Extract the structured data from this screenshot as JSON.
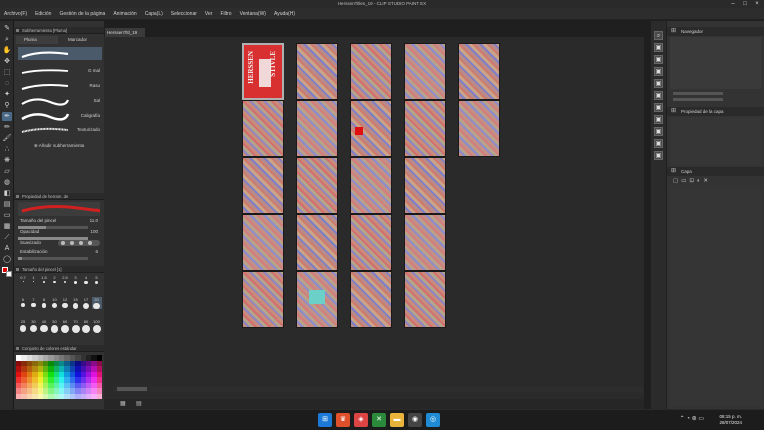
{
  "window": {
    "title": "HerssenTitles_19 - CLIP STUDIO PAINT EX"
  },
  "menu": [
    "Archivo(F)",
    "Edición",
    "Gestión de la página",
    "Animación",
    "Capa(L)",
    "Seleccionar",
    "Ver",
    "Filtro",
    "Ventana(W)",
    "Ayuda(H)"
  ],
  "left_panel": {
    "subtool_header": "Subherramienta [Pluma]",
    "tabs": [
      "Pluma",
      "Marcador"
    ],
    "brushes": [
      "",
      "G mal",
      "Rasu",
      "Sal",
      "Caligrafía",
      "Texturizado"
    ],
    "add_subtool": "Añadir subherramienta",
    "tool_props_header": "Propiedad de herram. de",
    "props": {
      "brush_size_label": "Tamaño del pincel",
      "brush_size_value": "11.0",
      "opacity_label": "Opacidad",
      "opacity_value": "100",
      "smoothing_label": "Suavizado",
      "stabilization_label": "Estabilización",
      "stabilization_value": "6"
    },
    "size_header": "Tamaño del pincel [1]",
    "sizes": [
      "0.7",
      "1",
      "1.5",
      "2",
      "2.5",
      "3",
      "4",
      "5",
      "6",
      "7",
      "8",
      "10",
      "12",
      "15",
      "17",
      "20",
      "25",
      "30",
      "40",
      "50",
      "60",
      "70",
      "80",
      "100"
    ],
    "palette_header": "Conjunto de colores estándar"
  },
  "document_tab": "HerssenTitl_19",
  "cover": {
    "line1": "HERSSEN",
    "line2": "STIVLE"
  },
  "right_panel": {
    "navigator": "Navegador",
    "layer_prop": "Propiedad de la capa",
    "layers": "Capa"
  },
  "taskbar": {
    "time": "08:15 p. m.",
    "date": "28/07/2024"
  },
  "colors": {
    "accent": "#4a6a8a",
    "cover_red": "#d83030",
    "fg_color": "#e00000",
    "bg_color": "#ffffff"
  }
}
